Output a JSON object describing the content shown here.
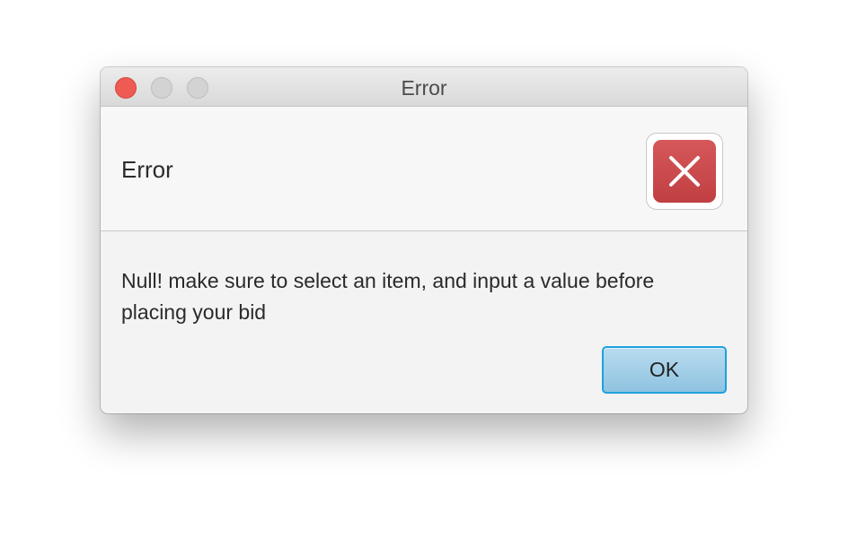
{
  "window": {
    "title": "Error"
  },
  "dialog": {
    "header_text": "Error",
    "message": "Null! make sure to select an item, and input a value before placing your bid",
    "icon": "error-x-icon",
    "ok_label": "OK"
  },
  "colors": {
    "close_button": "#ee5b52",
    "error_icon": "#c94a4c",
    "ok_button": "#a3d0ea",
    "focus_ring": "#1ea1dd"
  }
}
